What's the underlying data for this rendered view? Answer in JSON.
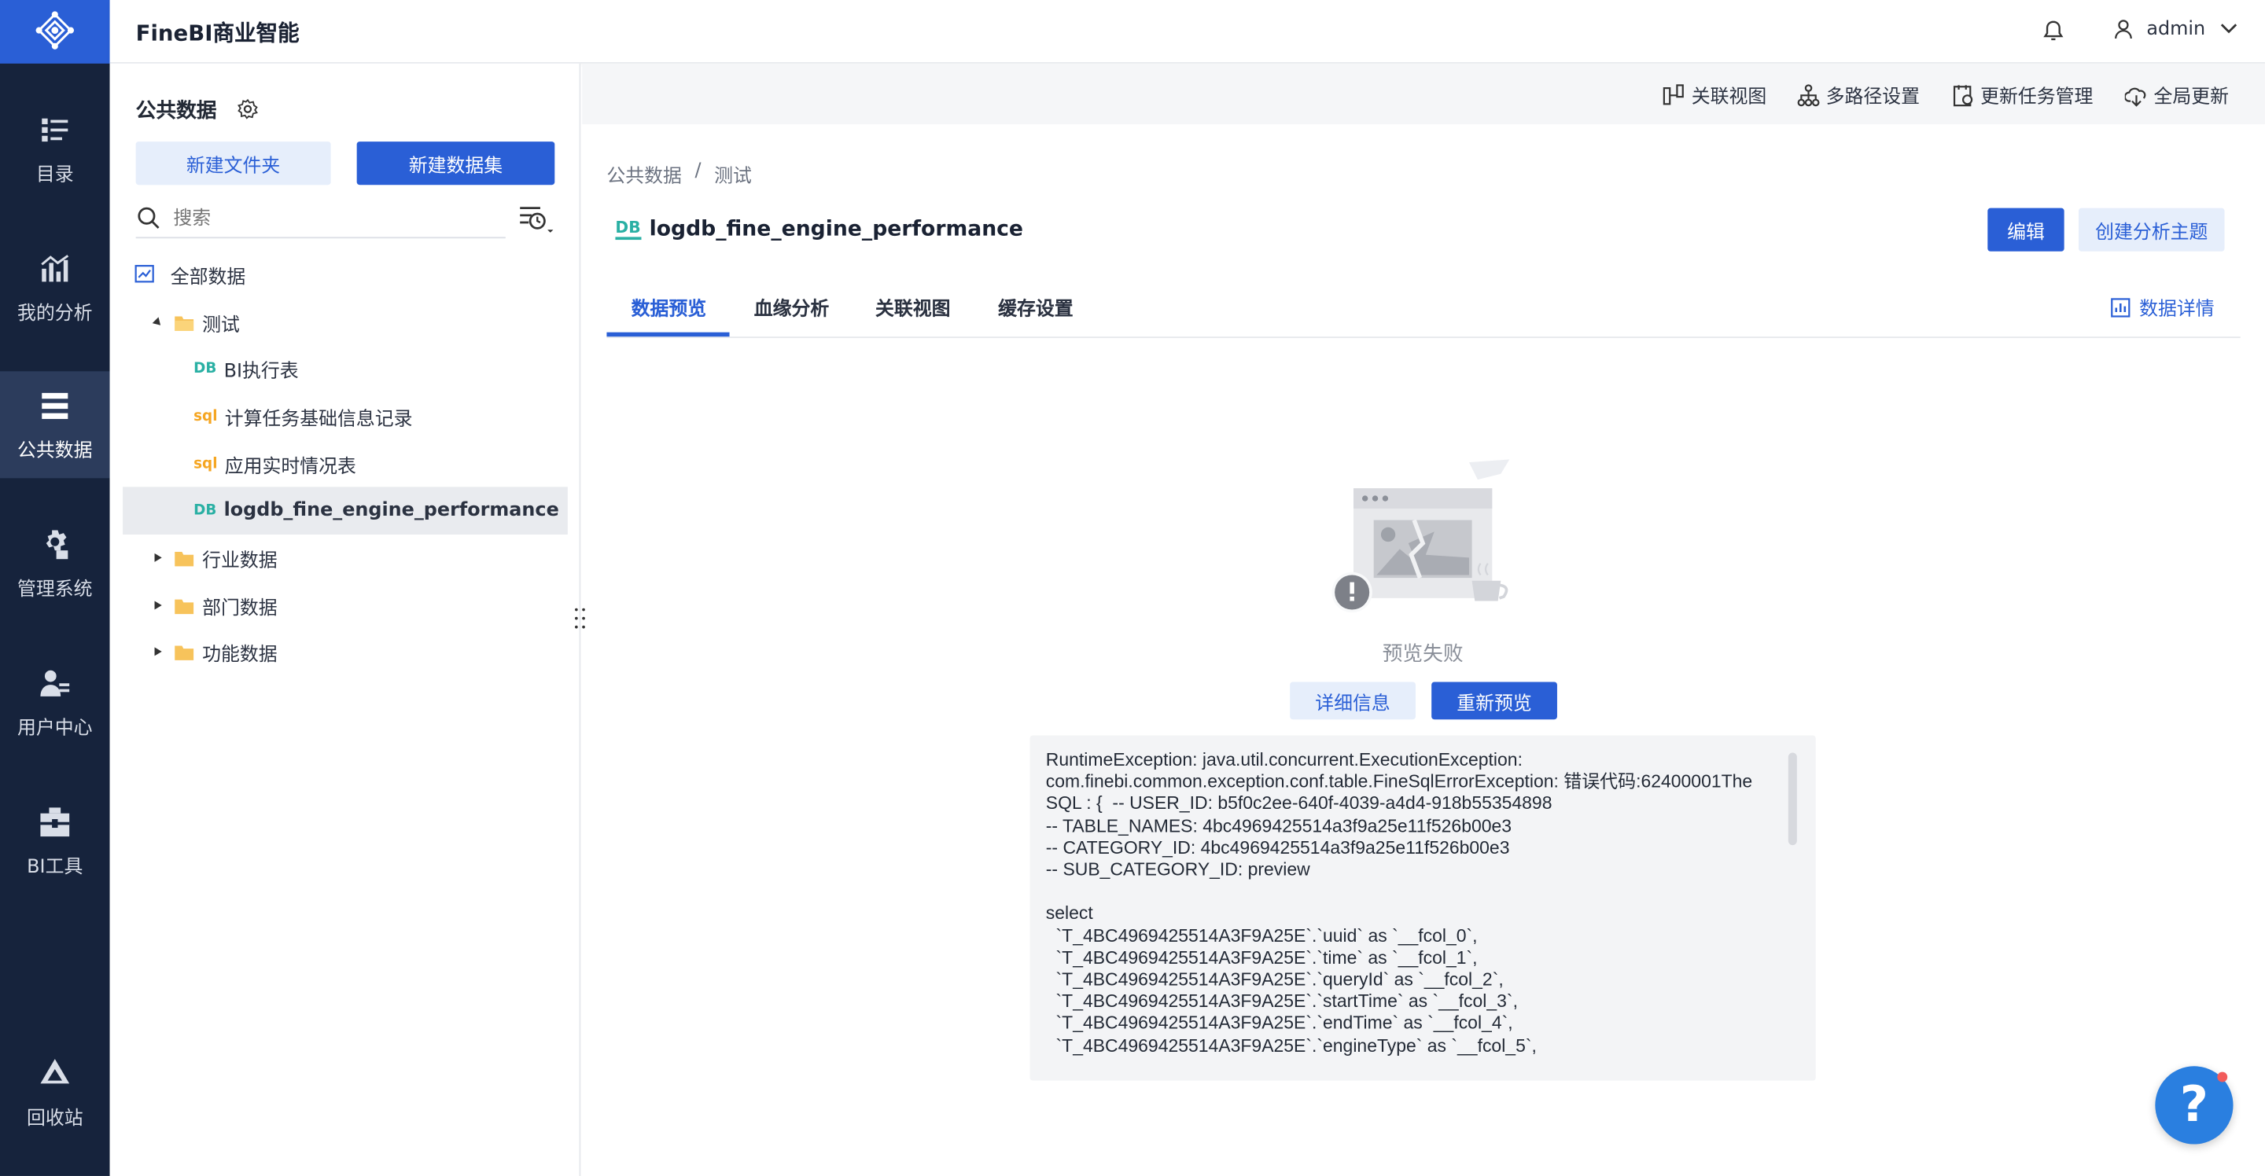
{
  "app": {
    "title": "FineBI商业智能",
    "user": "admin"
  },
  "nav": {
    "items": [
      "目录",
      "我的分析",
      "公共数据",
      "管理系统",
      "用户中心",
      "BI工具",
      "回收站"
    ],
    "active": "公共数据"
  },
  "colors": {
    "nav_bg": "#16233c",
    "accent": "#2a5fd6",
    "nav_active": "#2c3c5c"
  },
  "panel": {
    "title": "公共数据",
    "new_folder": "新建文件夹",
    "new_dataset": "新建数据集",
    "search_placeholder": "搜索",
    "tree": {
      "all": "全部数据",
      "folder_test": "测试",
      "items": [
        "BI执行表",
        "计算任务基础信息记录",
        "应用实时情况表",
        "logdb_fine_engine_performance"
      ],
      "item_types": [
        "DB",
        "sql",
        "sql",
        "DB"
      ],
      "folders": [
        "行业数据",
        "部门数据",
        "功能数据"
      ]
    }
  },
  "toolbar": {
    "items": [
      "关联视图",
      "多路径设置",
      "更新任务管理",
      "全局更新"
    ]
  },
  "breadcrumb": {
    "root": "公共数据",
    "sep": "/",
    "current": "测试"
  },
  "dataset": {
    "badge": "DB",
    "name": "logdb_fine_engine_performance",
    "edit": "编辑",
    "create_topic": "创建分析主题"
  },
  "tabs": {
    "items": [
      "数据预览",
      "血缘分析",
      "关联视图",
      "缓存设置"
    ],
    "active": "数据预览",
    "details": "数据详情"
  },
  "preview": {
    "status": "预览失败",
    "detail_btn": "详细信息",
    "retry_btn": "重新预览",
    "error": "RuntimeException: java.util.concurrent.ExecutionException:\ncom.finebi.common.exception.conf.table.FineSqlErrorException: 错误代码:62400001The\nSQL : {  -- USER_ID: b5f0c2ee-640f-4039-a4d4-918b55354898\n-- TABLE_NAMES: 4bc4969425514a3f9a25e11f526b00e3\n-- CATEGORY_ID: 4bc4969425514a3f9a25e11f526b00e3\n-- SUB_CATEGORY_ID: preview\n\nselect\n  `T_4BC4969425514A3F9A25E`.`uuid` as `__fcol_0`,\n  `T_4BC4969425514A3F9A25E`.`time` as `__fcol_1`,\n  `T_4BC4969425514A3F9A25E`.`queryId` as `__fcol_2`,\n  `T_4BC4969425514A3F9A25E`.`startTime` as `__fcol_3`,\n  `T_4BC4969425514A3F9A25E`.`endTime` as `__fcol_4`,\n  `T_4BC4969425514A3F9A25E`.`engineType` as `__fcol_5`,"
  },
  "help": {
    "label": "?"
  }
}
